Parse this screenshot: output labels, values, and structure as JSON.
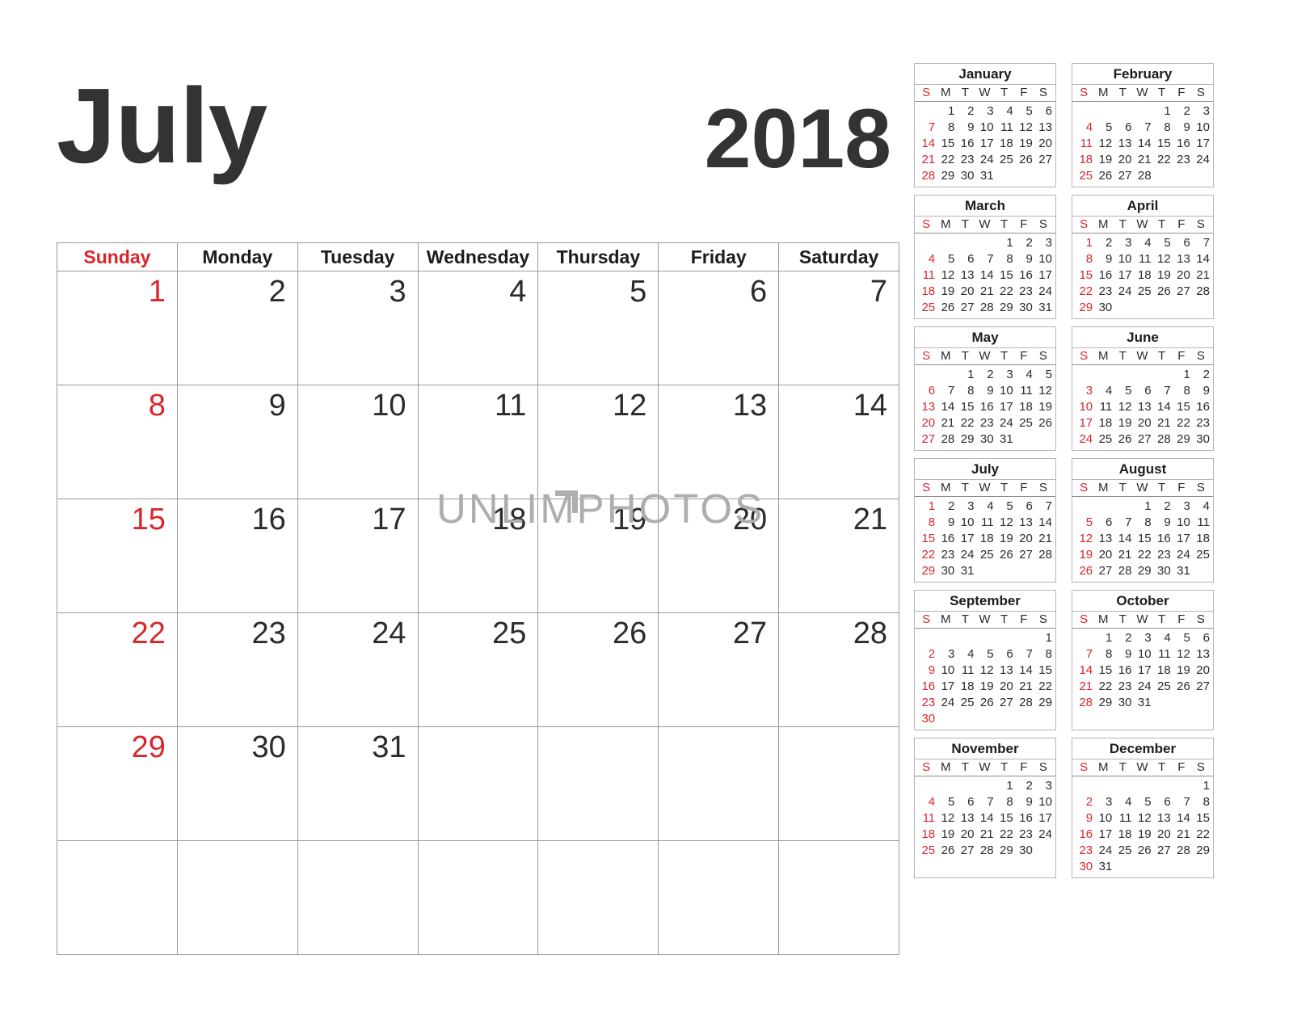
{
  "header": {
    "month": "July",
    "year": "2018"
  },
  "colors": {
    "sunday_red": "#d8262c",
    "text_dark": "#333333",
    "grid_line": "#9a9a9a",
    "watermark_gray": "#aeaeae"
  },
  "watermark": {
    "text": "UNLIMPHOTOS"
  },
  "main": {
    "weekday_headers": [
      "Sunday",
      "Monday",
      "Tuesday",
      "Wednesday",
      "Thursday",
      "Friday",
      "Saturday"
    ],
    "weeks": [
      [
        "1",
        "2",
        "3",
        "4",
        "5",
        "6",
        "7"
      ],
      [
        "8",
        "9",
        "10",
        "11",
        "12",
        "13",
        "14"
      ],
      [
        "15",
        "16",
        "17",
        "18",
        "19",
        "20",
        "21"
      ],
      [
        "22",
        "23",
        "24",
        "25",
        "26",
        "27",
        "28"
      ],
      [
        "29",
        "30",
        "31",
        "",
        "",
        "",
        ""
      ],
      [
        "",
        "",
        "",
        "",
        "",
        "",
        ""
      ]
    ]
  },
  "mini_dow": [
    "S",
    "M",
    "T",
    "W",
    "T",
    "F",
    "S"
  ],
  "mini_calendars": [
    {
      "name": "January",
      "weeks": [
        [
          "",
          "1",
          "2",
          "3",
          "4",
          "5",
          "6"
        ],
        [
          "7",
          "8",
          "9",
          "10",
          "11",
          "12",
          "13"
        ],
        [
          "14",
          "15",
          "16",
          "17",
          "18",
          "19",
          "20"
        ],
        [
          "21",
          "22",
          "23",
          "24",
          "25",
          "26",
          "27"
        ],
        [
          "28",
          "29",
          "30",
          "31",
          "",
          "",
          ""
        ]
      ]
    },
    {
      "name": "February",
      "weeks": [
        [
          "",
          "",
          "",
          "",
          "1",
          "2",
          "3"
        ],
        [
          "4",
          "5",
          "6",
          "7",
          "8",
          "9",
          "10"
        ],
        [
          "11",
          "12",
          "13",
          "14",
          "15",
          "16",
          "17"
        ],
        [
          "18",
          "19",
          "20",
          "21",
          "22",
          "23",
          "24"
        ],
        [
          "25",
          "26",
          "27",
          "28",
          "",
          "",
          ""
        ]
      ]
    },
    {
      "name": "March",
      "weeks": [
        [
          "",
          "",
          "",
          "",
          "1",
          "2",
          "3"
        ],
        [
          "4",
          "5",
          "6",
          "7",
          "8",
          "9",
          "10"
        ],
        [
          "11",
          "12",
          "13",
          "14",
          "15",
          "16",
          "17"
        ],
        [
          "18",
          "19",
          "20",
          "21",
          "22",
          "23",
          "24"
        ],
        [
          "25",
          "26",
          "27",
          "28",
          "29",
          "30",
          "31"
        ]
      ]
    },
    {
      "name": "April",
      "weeks": [
        [
          "1",
          "2",
          "3",
          "4",
          "5",
          "6",
          "7"
        ],
        [
          "8",
          "9",
          "10",
          "11",
          "12",
          "13",
          "14"
        ],
        [
          "15",
          "16",
          "17",
          "18",
          "19",
          "20",
          "21"
        ],
        [
          "22",
          "23",
          "24",
          "25",
          "26",
          "27",
          "28"
        ],
        [
          "29",
          "30",
          "",
          "",
          "",
          "",
          ""
        ]
      ]
    },
    {
      "name": "May",
      "weeks": [
        [
          "",
          "",
          "1",
          "2",
          "3",
          "4",
          "5"
        ],
        [
          "6",
          "7",
          "8",
          "9",
          "10",
          "11",
          "12"
        ],
        [
          "13",
          "14",
          "15",
          "16",
          "17",
          "18",
          "19"
        ],
        [
          "20",
          "21",
          "22",
          "23",
          "24",
          "25",
          "26"
        ],
        [
          "27",
          "28",
          "29",
          "30",
          "31",
          "",
          ""
        ]
      ]
    },
    {
      "name": "June",
      "weeks": [
        [
          "",
          "",
          "",
          "",
          "",
          "1",
          "2"
        ],
        [
          "3",
          "4",
          "5",
          "6",
          "7",
          "8",
          "9"
        ],
        [
          "10",
          "11",
          "12",
          "13",
          "14",
          "15",
          "16"
        ],
        [
          "17",
          "18",
          "19",
          "20",
          "21",
          "22",
          "23"
        ],
        [
          "24",
          "25",
          "26",
          "27",
          "28",
          "29",
          "30"
        ]
      ]
    },
    {
      "name": "July",
      "weeks": [
        [
          "1",
          "2",
          "3",
          "4",
          "5",
          "6",
          "7"
        ],
        [
          "8",
          "9",
          "10",
          "11",
          "12",
          "13",
          "14"
        ],
        [
          "15",
          "16",
          "17",
          "18",
          "19",
          "20",
          "21"
        ],
        [
          "22",
          "23",
          "24",
          "25",
          "26",
          "27",
          "28"
        ],
        [
          "29",
          "30",
          "31",
          "",
          "",
          "",
          ""
        ]
      ]
    },
    {
      "name": "August",
      "weeks": [
        [
          "",
          "",
          "",
          "1",
          "2",
          "3",
          "4"
        ],
        [
          "5",
          "6",
          "7",
          "8",
          "9",
          "10",
          "11"
        ],
        [
          "12",
          "13",
          "14",
          "15",
          "16",
          "17",
          "18"
        ],
        [
          "19",
          "20",
          "21",
          "22",
          "23",
          "24",
          "25"
        ],
        [
          "26",
          "27",
          "28",
          "29",
          "30",
          "31",
          ""
        ]
      ]
    },
    {
      "name": "September",
      "weeks": [
        [
          "",
          "",
          "",
          "",
          "",
          "",
          "1"
        ],
        [
          "2",
          "3",
          "4",
          "5",
          "6",
          "7",
          "8"
        ],
        [
          "9",
          "10",
          "11",
          "12",
          "13",
          "14",
          "15"
        ],
        [
          "16",
          "17",
          "18",
          "19",
          "20",
          "21",
          "22"
        ],
        [
          "23",
          "24",
          "25",
          "26",
          "27",
          "28",
          "29"
        ],
        [
          "30",
          "",
          "",
          "",
          "",
          "",
          ""
        ]
      ]
    },
    {
      "name": "October",
      "weeks": [
        [
          "",
          "1",
          "2",
          "3",
          "4",
          "5",
          "6"
        ],
        [
          "7",
          "8",
          "9",
          "10",
          "11",
          "12",
          "13"
        ],
        [
          "14",
          "15",
          "16",
          "17",
          "18",
          "19",
          "20"
        ],
        [
          "21",
          "22",
          "23",
          "24",
          "25",
          "26",
          "27"
        ],
        [
          "28",
          "29",
          "30",
          "31",
          "",
          "",
          ""
        ]
      ]
    },
    {
      "name": "November",
      "weeks": [
        [
          "",
          "",
          "",
          "",
          "1",
          "2",
          "3"
        ],
        [
          "4",
          "5",
          "6",
          "7",
          "8",
          "9",
          "10"
        ],
        [
          "11",
          "12",
          "13",
          "14",
          "15",
          "16",
          "17"
        ],
        [
          "18",
          "19",
          "20",
          "21",
          "22",
          "23",
          "24"
        ],
        [
          "25",
          "26",
          "27",
          "28",
          "29",
          "30",
          ""
        ]
      ]
    },
    {
      "name": "December",
      "weeks": [
        [
          "",
          "",
          "",
          "",
          "",
          "",
          "1"
        ],
        [
          "2",
          "3",
          "4",
          "5",
          "6",
          "7",
          "8"
        ],
        [
          "9",
          "10",
          "11",
          "12",
          "13",
          "14",
          "15"
        ],
        [
          "16",
          "17",
          "18",
          "19",
          "20",
          "21",
          "22"
        ],
        [
          "23",
          "24",
          "25",
          "26",
          "27",
          "28",
          "29"
        ],
        [
          "30",
          "31",
          "",
          "",
          "",
          "",
          ""
        ]
      ]
    }
  ]
}
